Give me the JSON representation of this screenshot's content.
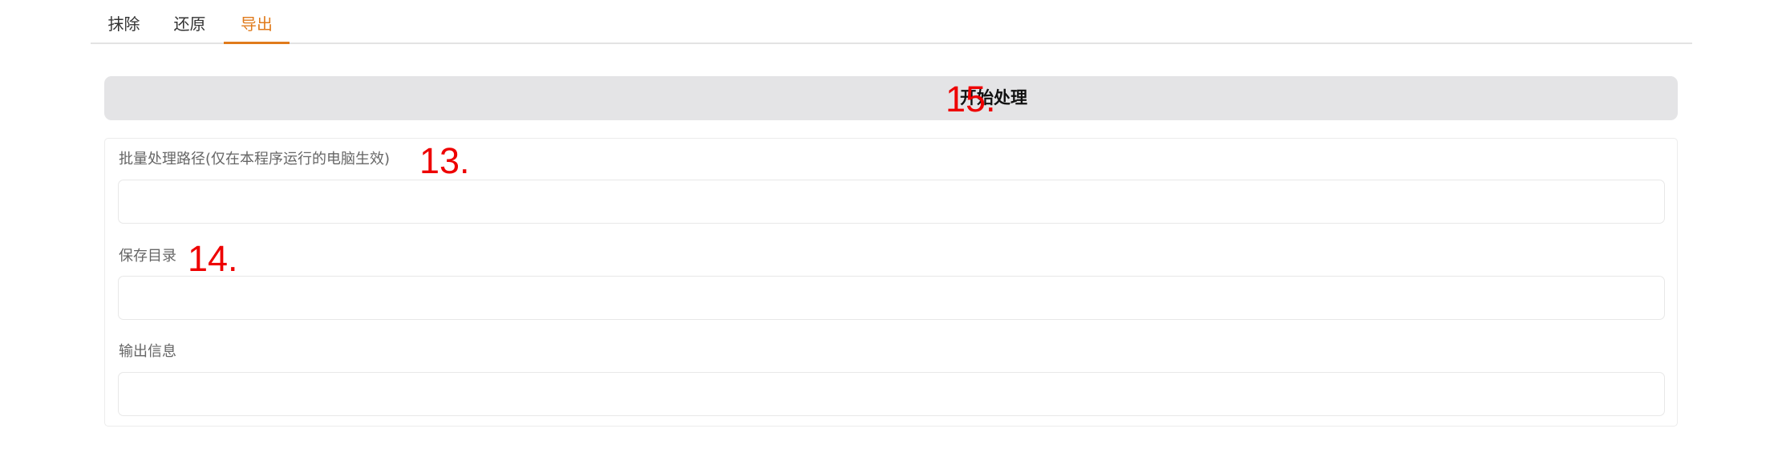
{
  "tabs": [
    {
      "label": "抹除",
      "active": false
    },
    {
      "label": "还原",
      "active": false
    },
    {
      "label": "导出",
      "active": true
    }
  ],
  "accent_color": "#e07b1c",
  "start_button": {
    "label": "开始处理"
  },
  "annotation_color": "#ee0000",
  "annotations": {
    "start": "15.",
    "batch_path": "13.",
    "save_dir": "14."
  },
  "fields": {
    "batch_path": {
      "label": "批量处理路径(仅在本程序运行的电脑生效)",
      "value": ""
    },
    "save_dir": {
      "label": "保存目录",
      "value": ""
    },
    "output_info": {
      "label": "输出信息",
      "value": ""
    }
  }
}
